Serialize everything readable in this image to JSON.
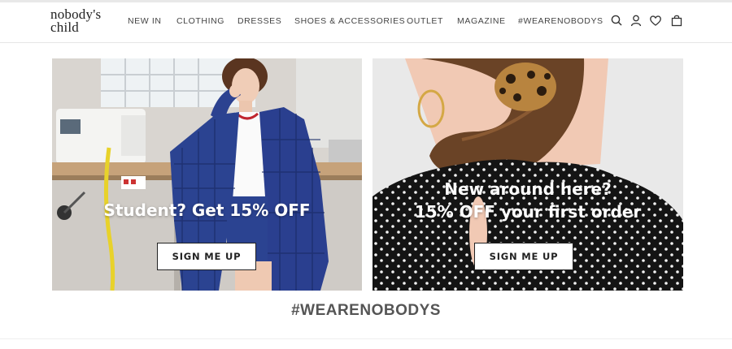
{
  "brand": {
    "logo_line1": "nobody's",
    "logo_line2": "child"
  },
  "nav": {
    "items": [
      {
        "label": "NEW IN"
      },
      {
        "label": "CLOTHING"
      },
      {
        "label": "DRESSES"
      },
      {
        "label": "SHOES & ACCESSORIES"
      },
      {
        "label": "OUTLET"
      },
      {
        "label": "MAGAZINE"
      },
      {
        "label": "#WEARENOBODYS"
      }
    ]
  },
  "header_icons": [
    "search-icon",
    "account-icon",
    "wishlist-heart-icon",
    "shopping-bag-icon"
  ],
  "banners": [
    {
      "headline": "Student? Get 15% OFF",
      "cta": "SIGN ME UP"
    },
    {
      "headline_line1": "New around here?",
      "headline_line2": "15% OFF your first order",
      "cta": "SIGN ME UP"
    }
  ],
  "section": {
    "title": "#WEARENOBODYS"
  },
  "colors": {
    "text": "#333333",
    "accent_blue_plaid": "#2a3f8f",
    "heading_gray": "#555555"
  }
}
